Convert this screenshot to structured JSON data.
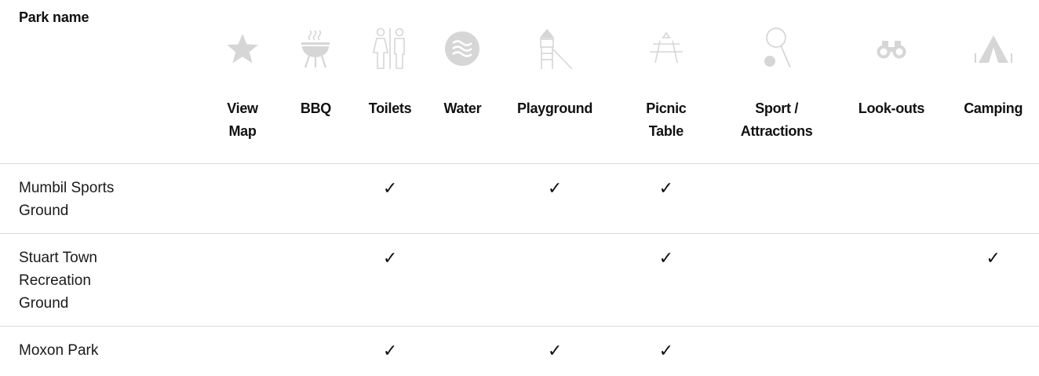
{
  "table": {
    "name_header": "Park name",
    "facilities": [
      {
        "key": "view_map",
        "label_lines": [
          "View",
          "Map"
        ],
        "icon": "star-icon"
      },
      {
        "key": "bbq",
        "label_lines": [
          "BBQ"
        ],
        "icon": "bbq-icon"
      },
      {
        "key": "toilets",
        "label_lines": [
          "Toilets"
        ],
        "icon": "toilets-icon"
      },
      {
        "key": "water",
        "label_lines": [
          "Water"
        ],
        "icon": "water-icon"
      },
      {
        "key": "playground",
        "label_lines": [
          "Playground"
        ],
        "icon": "playground-icon"
      },
      {
        "key": "picnic_table",
        "label_lines": [
          "Picnic",
          "Table"
        ],
        "icon": "picnic-table-icon"
      },
      {
        "key": "sport",
        "label_lines": [
          "Sport /",
          "Attractions"
        ],
        "icon": "sport-icon"
      },
      {
        "key": "lookouts",
        "label_lines": [
          "Look-outs"
        ],
        "icon": "binoculars-icon"
      },
      {
        "key": "camping",
        "label_lines": [
          "Camping"
        ],
        "icon": "tent-icon"
      }
    ],
    "check_symbol": "✓",
    "rows": [
      {
        "name_lines": [
          "Mumbil Sports",
          "Ground"
        ],
        "checks": [
          false,
          false,
          true,
          false,
          true,
          true,
          false,
          false,
          false
        ]
      },
      {
        "name_lines": [
          "Stuart Town",
          "Recreation",
          "Ground"
        ],
        "checks": [
          false,
          false,
          true,
          false,
          false,
          true,
          false,
          false,
          true
        ]
      },
      {
        "name_lines": [
          "Moxon Park"
        ],
        "checks": [
          false,
          false,
          true,
          false,
          true,
          true,
          false,
          false,
          false
        ]
      }
    ]
  },
  "colors": {
    "icon_gray": "#d6d6d6",
    "divider": "#dcdcdc",
    "text": "#111111"
  }
}
